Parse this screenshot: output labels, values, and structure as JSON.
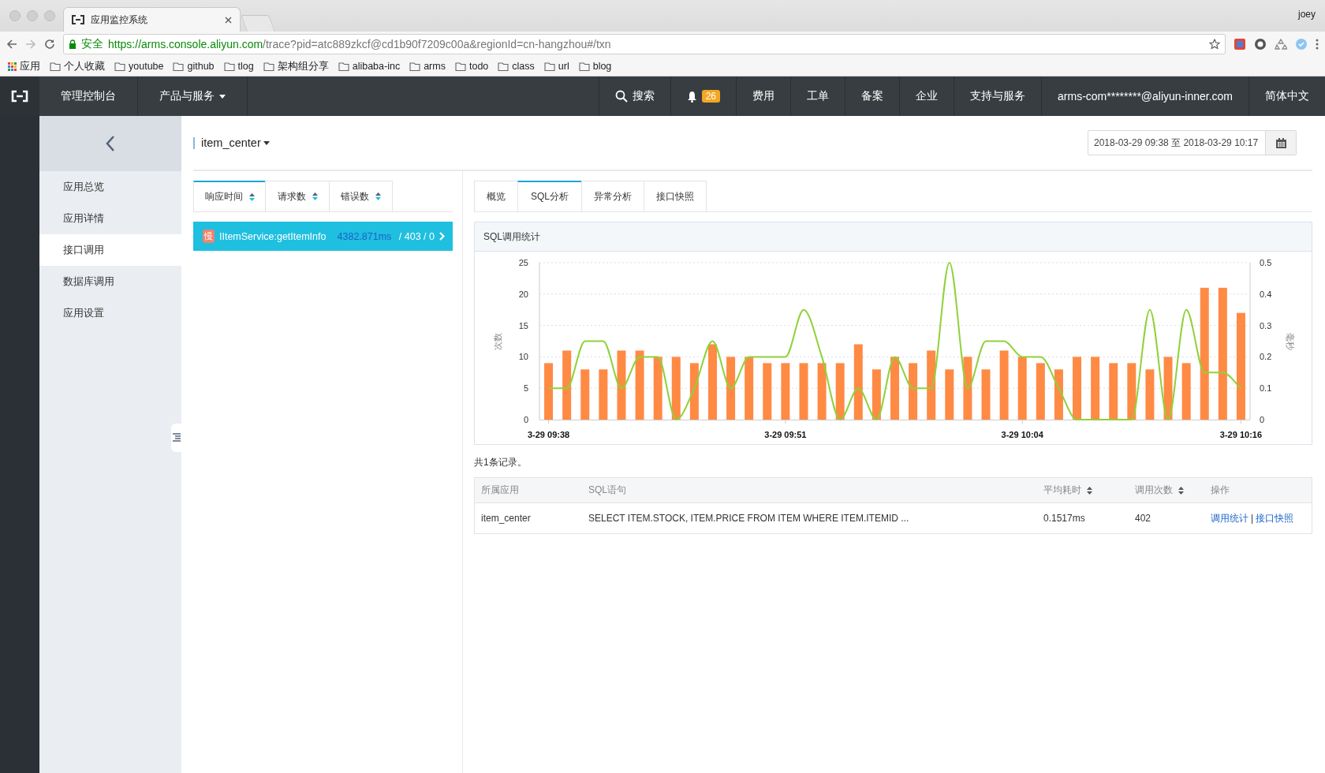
{
  "browser": {
    "tab_title": "应用监控系统",
    "user": "joey",
    "secure_label": "安全",
    "url_host": "https://arms.console.aliyun.com",
    "url_path": "/trace?pid=atc889zkcf@cd1b90f7209c00a&regionId=cn-hangzhou#/txn",
    "bookmarks": [
      {
        "label": "应用",
        "kind": "apps"
      },
      {
        "label": "个人收藏",
        "kind": "folder"
      },
      {
        "label": "youtube",
        "kind": "folder"
      },
      {
        "label": "github",
        "kind": "folder"
      },
      {
        "label": "tlog",
        "kind": "folder"
      },
      {
        "label": "架构组分享",
        "kind": "folder"
      },
      {
        "label": "alibaba-inc",
        "kind": "folder"
      },
      {
        "label": "arms",
        "kind": "folder"
      },
      {
        "label": "todo",
        "kind": "folder"
      },
      {
        "label": "class",
        "kind": "folder"
      },
      {
        "label": "url",
        "kind": "folder"
      },
      {
        "label": "blog",
        "kind": "folder"
      }
    ]
  },
  "topnav": {
    "left_items": [
      {
        "label": "管理控制台",
        "kind": "link"
      },
      {
        "label": "产品与服务",
        "kind": "dropdown"
      }
    ],
    "right_items": [
      {
        "label": "搜索",
        "kind": "search"
      },
      {
        "label": "26",
        "kind": "notifications"
      },
      {
        "label": "费用",
        "kind": "link"
      },
      {
        "label": "工单",
        "kind": "link"
      },
      {
        "label": "备案",
        "kind": "link"
      },
      {
        "label": "企业",
        "kind": "link"
      },
      {
        "label": "支持与服务",
        "kind": "link"
      },
      {
        "label": "arms-com********@aliyun-inner.com",
        "kind": "link"
      },
      {
        "label": "简体中文",
        "kind": "link"
      }
    ]
  },
  "sidebar": {
    "items": [
      {
        "label": "应用总览",
        "selected": false
      },
      {
        "label": "应用详情",
        "selected": false
      },
      {
        "label": "接口调用",
        "selected": true
      },
      {
        "label": "数据库调用",
        "selected": false
      },
      {
        "label": "应用设置",
        "selected": false
      }
    ]
  },
  "app_selector": "item_center",
  "date_range": "2018-03-29 09:38 至 2018-03-29 10:17",
  "sort_tabs": [
    {
      "label": "响应时间",
      "selected": true
    },
    {
      "label": "请求数",
      "selected": false
    },
    {
      "label": "错误数",
      "selected": false
    }
  ],
  "interfaces": [
    {
      "badge": "慢",
      "name": "IItemService:getItemInfo",
      "time": "4382.871ms",
      "counts": " / 403 / 0",
      "selected": true
    }
  ],
  "detail_tabs": [
    {
      "label": "概览",
      "selected": false
    },
    {
      "label": "SQL分析",
      "selected": true
    },
    {
      "label": "异常分析",
      "selected": false
    },
    {
      "label": "接口快照",
      "selected": false
    }
  ],
  "chart_panel": {
    "title": "SQL调用统计",
    "chart_data": {
      "type": "bar",
      "ylabel": "次数",
      "y2label": "毫秒",
      "categories": [
        "3-29 09:38",
        null,
        null,
        null,
        null,
        null,
        null,
        null,
        null,
        null,
        null,
        null,
        null,
        "3-29 09:51",
        null,
        null,
        null,
        null,
        null,
        null,
        null,
        null,
        null,
        null,
        null,
        null,
        "3-29 10:04",
        null,
        null,
        null,
        null,
        null,
        null,
        null,
        null,
        null,
        null,
        null,
        "3-29 10:16"
      ],
      "grid": true,
      "series": [
        {
          "color": "#ff8a44",
          "values": [
            9,
            11,
            8,
            8,
            11,
            11,
            10,
            10,
            9,
            12,
            10,
            10,
            9,
            9,
            9,
            9,
            9,
            12,
            8,
            10,
            9,
            11,
            8,
            10,
            8,
            11,
            10,
            9,
            8,
            10,
            10,
            9,
            9,
            8,
            10,
            9,
            21,
            21,
            17
          ]
        },
        {
          "type": "line",
          "axis": "y2",
          "color": "#8fd13a",
          "values": [
            0.1,
            0.1,
            0.25,
            0.25,
            0.1,
            0.2,
            0.2,
            0,
            0.1,
            0.25,
            0.1,
            0.2,
            0.2,
            0.2,
            0.35,
            0.2,
            0,
            0.1,
            0,
            0.2,
            0.1,
            0.1,
            0.5,
            0.1,
            0.25,
            0.25,
            0.2,
            0.2,
            0.1,
            0,
            0,
            0,
            0,
            0.35,
            0,
            0.35,
            0.15,
            0.15,
            0.1
          ]
        }
      ],
      "ylim": [
        0,
        25
      ],
      "yticks": [
        0,
        5,
        10,
        15,
        20,
        25
      ],
      "y2lim": [
        0,
        0.5
      ],
      "y2ticks": [
        0,
        0.1,
        0.2,
        0.3,
        0.4,
        0.5
      ]
    }
  },
  "record_count": "共1条记录。",
  "table": {
    "columns": [
      {
        "label": "所属应用",
        "sortable": false
      },
      {
        "label": "SQL语句",
        "sortable": false
      },
      {
        "label": "平均耗时",
        "sortable": true
      },
      {
        "label": "调用次数",
        "sortable": true
      },
      {
        "label": "操作",
        "sortable": false
      }
    ],
    "rows": [
      {
        "cells": [
          "item_center",
          "SELECT ITEM.STOCK, ITEM.PRICE FROM ITEM WHERE ITEM.ITEMID ...",
          "0.1517ms",
          "402"
        ],
        "actions": [
          "调用统计",
          "接口快照"
        ],
        "separator": "|"
      }
    ]
  }
}
